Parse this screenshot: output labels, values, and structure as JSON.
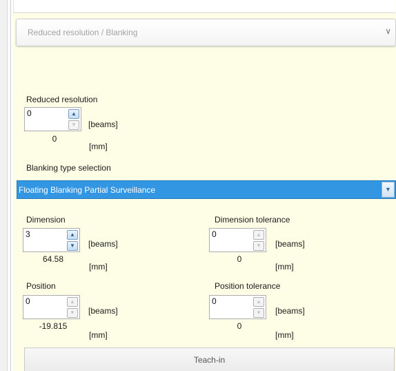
{
  "section": {
    "title": "Reduced resolution / Blanking",
    "chevron_icon": "chevron-down-icon"
  },
  "reduced_resolution": {
    "label": "Reduced resolution",
    "beams_value": "0",
    "beams_unit": "[beams]",
    "mm_value": "0",
    "mm_unit": "[mm]"
  },
  "blanking": {
    "label": "Blanking type selection",
    "selected": "Floating Blanking Partial Surveillancе"
  },
  "dimension": {
    "label": "Dimension",
    "beams_value": "3",
    "beams_unit": "[beams]",
    "mm_value": "64.58",
    "mm_unit": "[mm]"
  },
  "dimension_tolerance": {
    "label": "Dimension tolerance",
    "beams_value": "0",
    "beams_unit": "[beams]",
    "mm_value": "0",
    "mm_unit": "[mm]"
  },
  "position": {
    "label": "Position",
    "beams_value": "0",
    "beams_unit": "[beams]",
    "mm_value": "-19.815",
    "mm_unit": "[mm]"
  },
  "position_tolerance": {
    "label": "Position tolerance",
    "beams_value": "0",
    "beams_unit": "[beams]",
    "mm_value": "0",
    "mm_unit": "[mm]"
  },
  "teach_in": {
    "label": "Teach-in"
  },
  "colors": {
    "panel_bg": "#fefee6",
    "selection_blue": "#3296e2"
  }
}
